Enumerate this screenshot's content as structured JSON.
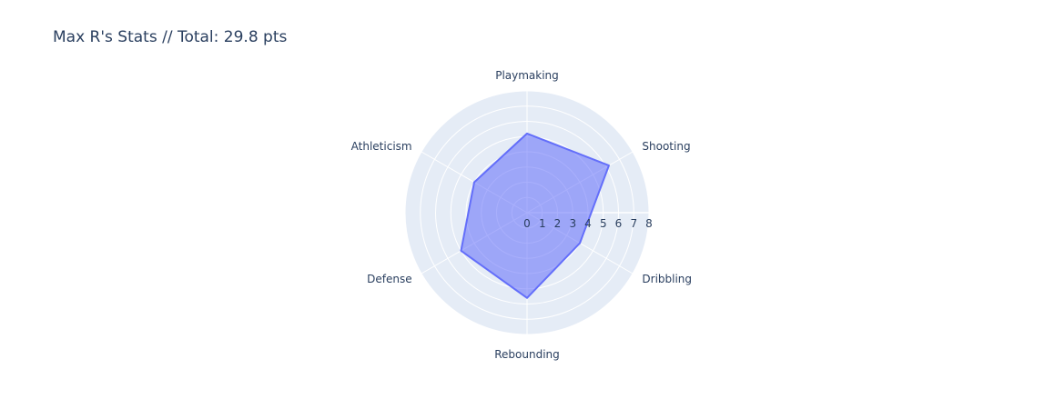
{
  "chart_data": {
    "type": "radar",
    "title": "Max R's Stats // Total: 29.8 pts",
    "categories": [
      "Playmaking",
      "Shooting",
      "Dribbling",
      "Rebounding",
      "Defense",
      "Athleticism"
    ],
    "series": [
      {
        "values": [
          5.2,
          6.2,
          4.0,
          5.6,
          5.0,
          4.0
        ]
      }
    ],
    "radial_ticks": [
      "0",
      "1",
      "2",
      "3",
      "4",
      "5",
      "6",
      "7",
      "8"
    ],
    "rlim": [
      0,
      8
    ],
    "legend": false,
    "grid": true,
    "colors": {
      "fill": "rgba(99,110,250,0.55)",
      "line": "#636efa",
      "polar_bg": "#e5ecf6",
      "grid": "#ffffff",
      "text": "#2a3f5f"
    }
  }
}
